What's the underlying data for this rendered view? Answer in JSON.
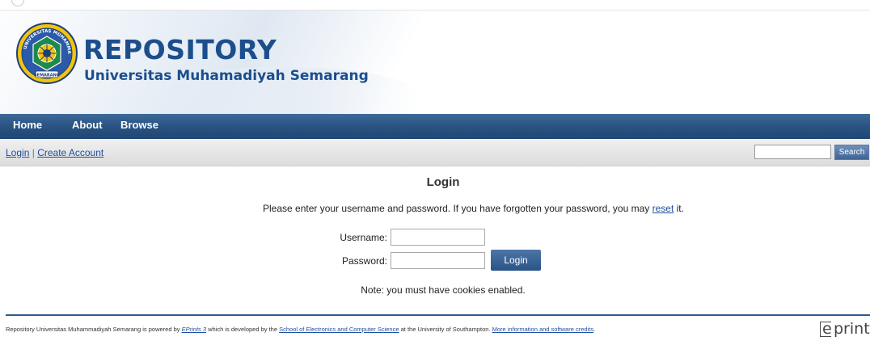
{
  "header": {
    "title": "REPOSITORY",
    "subtitle": "Universitas Muhamadiyah Semarang",
    "seal_text": "SEMARANG",
    "brand_color": "#1c4e8c"
  },
  "nav": {
    "items": [
      {
        "label": "Home"
      },
      {
        "label": "About"
      },
      {
        "label": "Browse"
      }
    ]
  },
  "loginbar": {
    "login_label": "Login",
    "separator": "|",
    "create_account_label": "Create Account",
    "search_button_label": "Search",
    "search_value": ""
  },
  "main": {
    "title": "Login",
    "instructions_before": "Please enter your username and password. If you have forgotten your password, you may ",
    "reset_link": "reset",
    "instructions_after": " it.",
    "username_label": "Username:",
    "password_label": "Password:",
    "username_value": "",
    "password_value": "",
    "login_button_label": "Login",
    "note": "Note: you must have cookies enabled."
  },
  "footer": {
    "t1": "Repository Universitas Muhammadiyah Semarang is powered by ",
    "eprints_link": "EPrints 3",
    "t2": " which is developed by the ",
    "school_link": "School of Electronics and Computer Science",
    "t3": " at the University of Southampton. ",
    "credits_link": "More information and software credits",
    "t4": ".",
    "logo_e": "e",
    "logo_rest": "prints"
  }
}
